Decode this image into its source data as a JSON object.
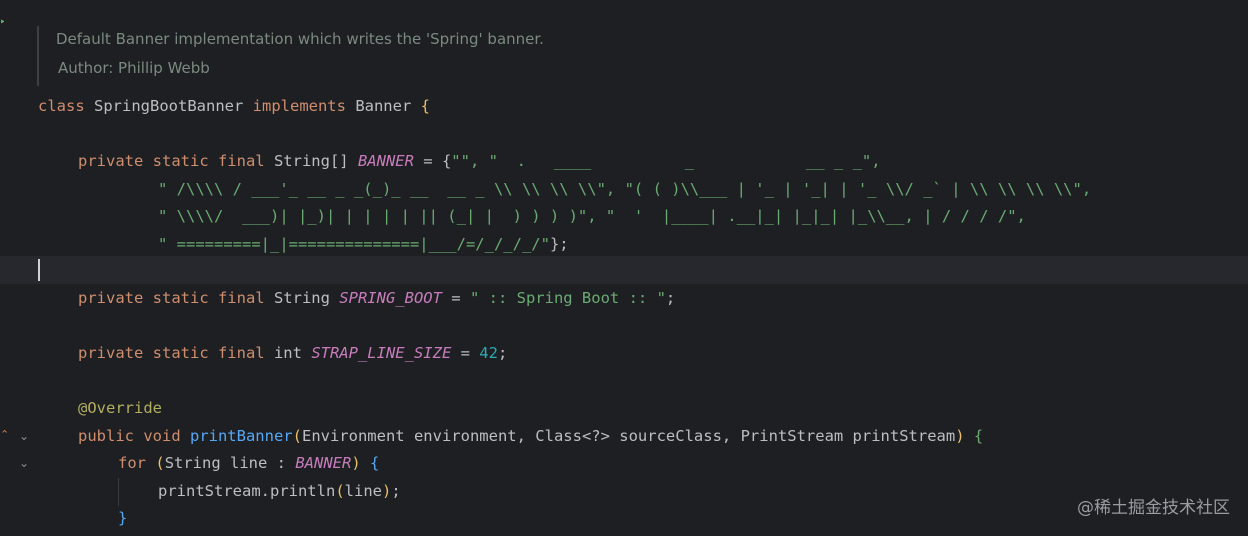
{
  "javadoc": {
    "description": "Default Banner implementation which writes the 'Spring' banner.",
    "author": "Author: Phillip Webb"
  },
  "code": {
    "class_decl": {
      "kw_class": "class",
      "class_name": " SpringBootBanner ",
      "kw_implements": "implements",
      "iface": " Banner ",
      "open_brace": "{"
    },
    "banner_decl": {
      "modifiers": "private static final",
      "type": " String[] ",
      "field": "BANNER",
      "assign": " = {",
      "values": [
        "\"\", \"  .   ____          _            __ _ _\",",
        "\" /\\\\\\\\ / ___'_ __ _ _(_)_ __  __ _ \\\\ \\\\ \\\\ \\\\\", \"( ( )\\\\___ | '_ | '_| | '_ \\\\/ _` | \\\\ \\\\ \\\\ \\\\\",",
        "\" \\\\\\\\/  ___)| |_)| | | | | || (_| |  ) ) ) )\", \"  '  |____| .__|_| |_|_| |_\\\\__, | / / / /\",",
        "\" =========|_|==============|___/=/_/_/_/\""
      ],
      "close": "};"
    },
    "spring_boot_decl": {
      "modifiers": "private static final",
      "type": " String ",
      "field": "SPRING_BOOT",
      "assign": " = ",
      "value": "\" :: Spring Boot :: \"",
      "end": ";"
    },
    "strap_decl": {
      "modifiers": "private static final",
      "type": " int ",
      "field": "STRAP_LINE_SIZE",
      "assign": " = ",
      "value": "42",
      "end": ";"
    },
    "annotation": "@Override",
    "method_decl": {
      "modifiers": "public void ",
      "name": "printBanner",
      "open_paren": "(",
      "params": "Environment environment, Class<?> sourceClass, PrintStream printStream",
      "close_paren": ")",
      "open_brace": " {"
    },
    "for_stmt": {
      "kw_for": "for",
      "space": " ",
      "open_paren": "(",
      "decl": "String line : ",
      "field": "BANNER",
      "close_paren": ")",
      "open_brace": " {"
    },
    "println_stmt": {
      "call": "printStream.println",
      "open_paren": "(",
      "arg": "line",
      "close_paren": ")",
      "end": ";"
    },
    "for_close": "}"
  },
  "watermark": "@稀土掘金技术社区",
  "colors": {
    "background": "#1e1f22",
    "keyword": "#cf8e6d",
    "field": "#c77dbb",
    "string": "#6aab73",
    "number": "#2aacb8",
    "annotation": "#b3ae60",
    "method": "#56a8f5",
    "text": "#bcbec4"
  }
}
